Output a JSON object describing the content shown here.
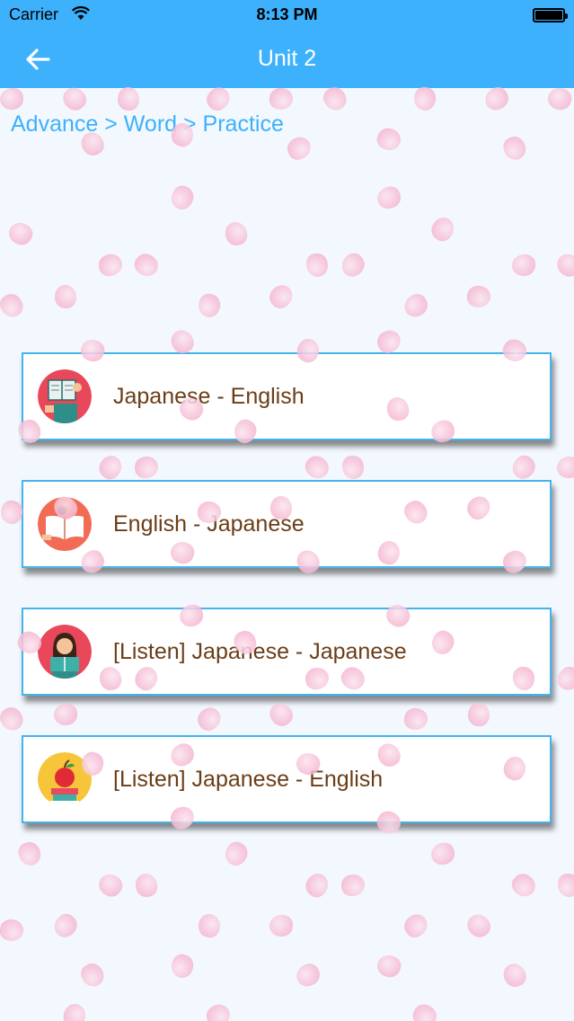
{
  "status_bar": {
    "carrier": "Carrier",
    "time": "8:13 PM"
  },
  "nav": {
    "title": "Unit 2",
    "back_icon": "arrow-left-icon"
  },
  "breadcrumb": "Advance > Word > Practice",
  "options": [
    {
      "label": "Japanese - English",
      "icon": "books-reader-icon"
    },
    {
      "label": "English - Japanese",
      "icon": "open-book-icon"
    },
    {
      "label": "[Listen] Japanese - Japanese",
      "icon": "girl-reading-icon"
    },
    {
      "label": "[Listen] Japanese - English",
      "icon": "apple-books-icon"
    }
  ],
  "colors": {
    "accent": "#3db1fb",
    "card_border": "#45b3ee",
    "label_text": "#6b3d17",
    "petal": "#f6bfd6"
  }
}
